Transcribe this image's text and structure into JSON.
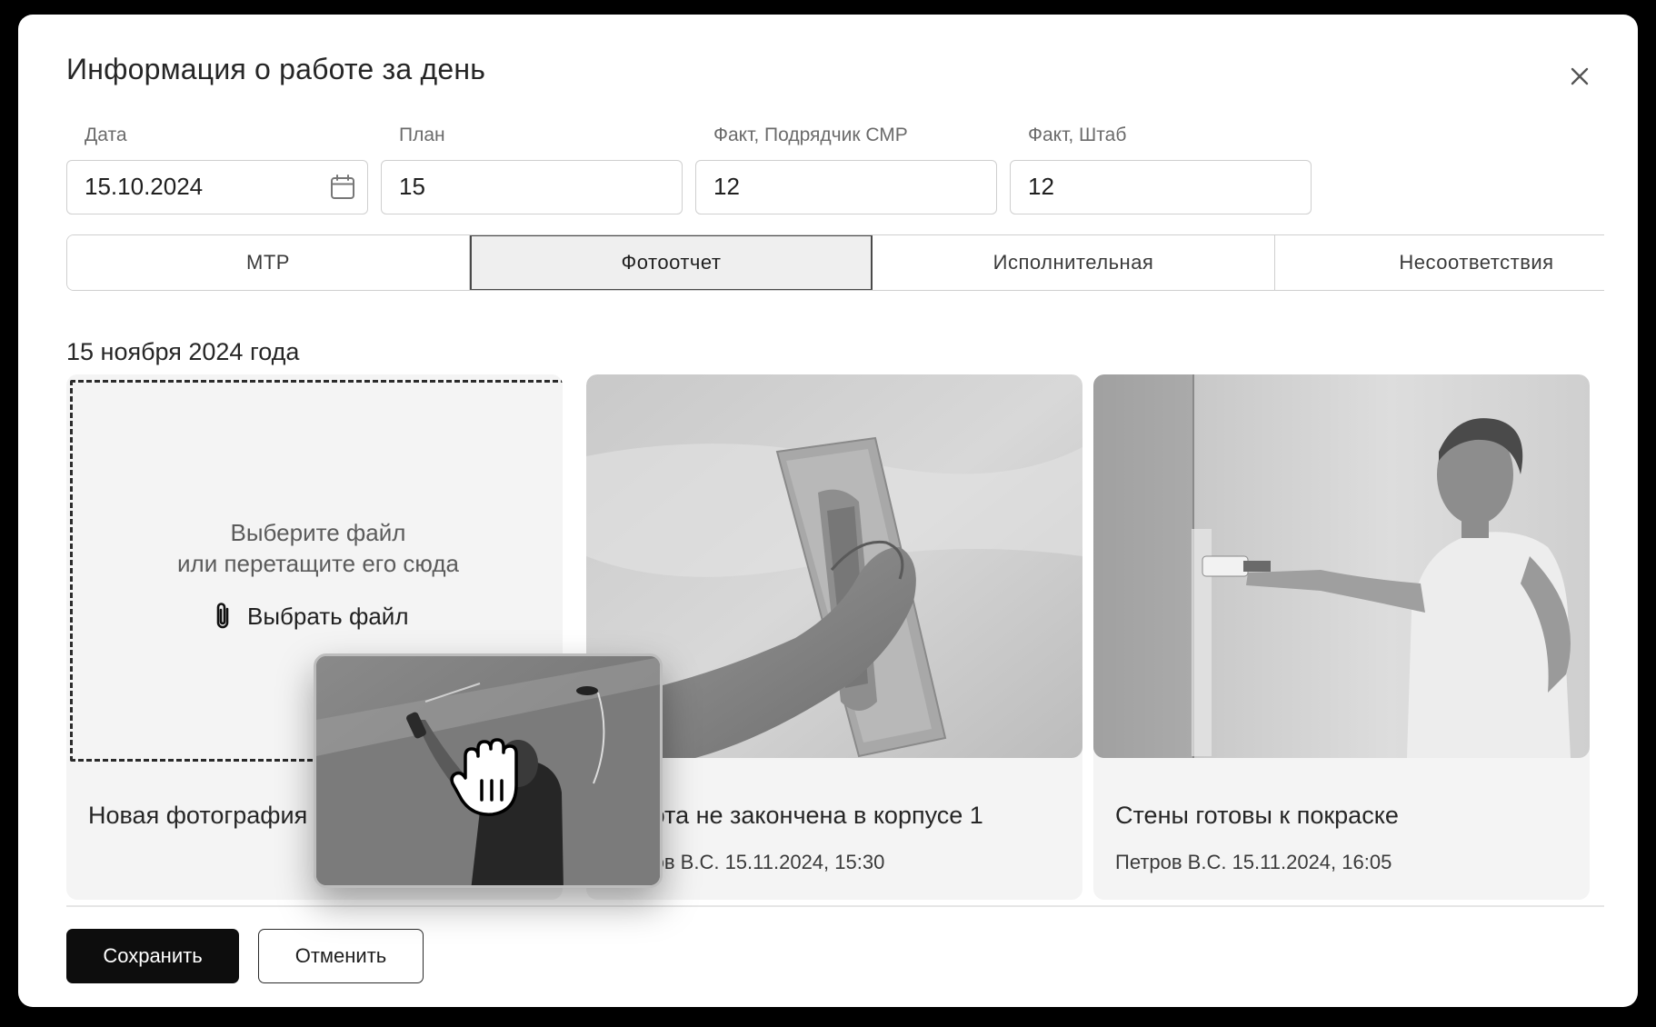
{
  "modal": {
    "title": "Информация о работе за день"
  },
  "fields": {
    "date": {
      "label": "Дата",
      "value": "15.10.2024"
    },
    "plan": {
      "label": "План",
      "value": "15"
    },
    "fact_contractor": {
      "label": "Факт, Подрядчик СМР",
      "value": "12"
    },
    "fact_hq": {
      "label": "Факт, Штаб",
      "value": "12"
    }
  },
  "tabs": [
    {
      "label": "МТР",
      "active": false
    },
    {
      "label": "Фотоотчет",
      "active": true
    },
    {
      "label": "Исполнительная",
      "active": false
    },
    {
      "label": "Несоответствия",
      "active": false
    }
  ],
  "report": {
    "date_heading": "15 ноября 2024 года",
    "upload": {
      "line1": "Выберите файл",
      "line2": "или перетащите его сюда",
      "choose_label": "Выбрать файл",
      "new_photo_title": "Новая фотография"
    },
    "photos": [
      {
        "title": "Работа не закончена в корпусе 1",
        "meta": "Петров В.С. 15.11.2024, 15:30"
      },
      {
        "title": "Стены готовы к покраске",
        "meta": "Петров В.С. 15.11.2024, 16:05"
      }
    ]
  },
  "actions": {
    "save_label": "Сохранить",
    "cancel_label": "Отменить"
  },
  "icons": {
    "close": "close-icon",
    "calendar": "calendar-icon",
    "attach": "paperclip-icon",
    "drag": "grab-hand-cursor-icon"
  }
}
